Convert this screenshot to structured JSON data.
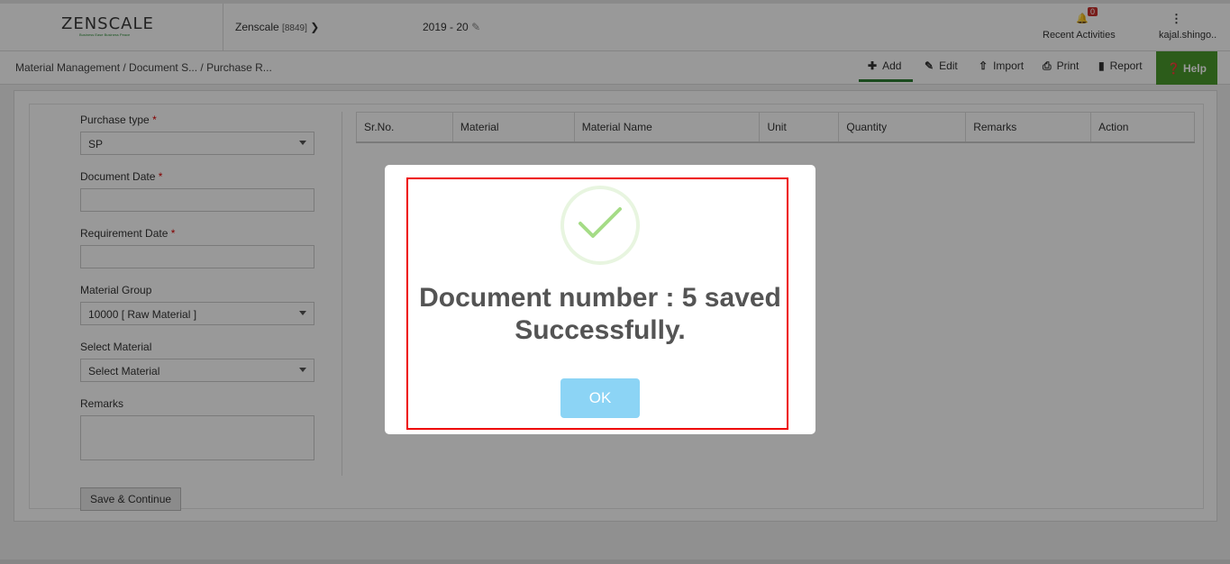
{
  "header": {
    "logo_text": "ZENSCALE",
    "logo_tagline": "Business Ease Business Peace",
    "company_name": "Zenscale",
    "company_code": "[8849]",
    "financial_year": "2019 - 20",
    "notification_count": "0",
    "recent_activities": "Recent Activities",
    "user_name": "kajal.shingo.."
  },
  "breadcrumb": "Material Management  / Document S... / Purchase R...",
  "toolbar": {
    "add": "Add",
    "edit": "Edit",
    "import": "Import",
    "print": "Print",
    "report": "Report",
    "help": "Help"
  },
  "form": {
    "purchase_type_label": "Purchase type",
    "purchase_type_value": "SP",
    "document_date_label": "Document Date",
    "document_date_value": "",
    "requirement_date_label": "Requirement Date",
    "requirement_date_value": "",
    "material_group_label": "Material Group",
    "material_group_value": "10000 [ Raw Material ]",
    "select_material_label": "Select Material",
    "select_material_value": "Select Material",
    "remarks_label": "Remarks",
    "remarks_value": "",
    "required_mark": "*",
    "save_continue": "Save & Continue"
  },
  "table": {
    "columns": [
      "Sr.No.",
      "Material",
      "Material Name",
      "Unit",
      "Quantity",
      "Remarks",
      "Action"
    ]
  },
  "modal": {
    "line1": "Document number : 5 saved",
    "line2": "Successfully.",
    "ok_label": "OK"
  },
  "colors": {
    "help_bg": "#4a9a2c",
    "add_underline": "#2e7d32",
    "ok_bg": "#8cd4f5",
    "highlight_border": "#e00000",
    "check_color": "#a5dc86"
  }
}
